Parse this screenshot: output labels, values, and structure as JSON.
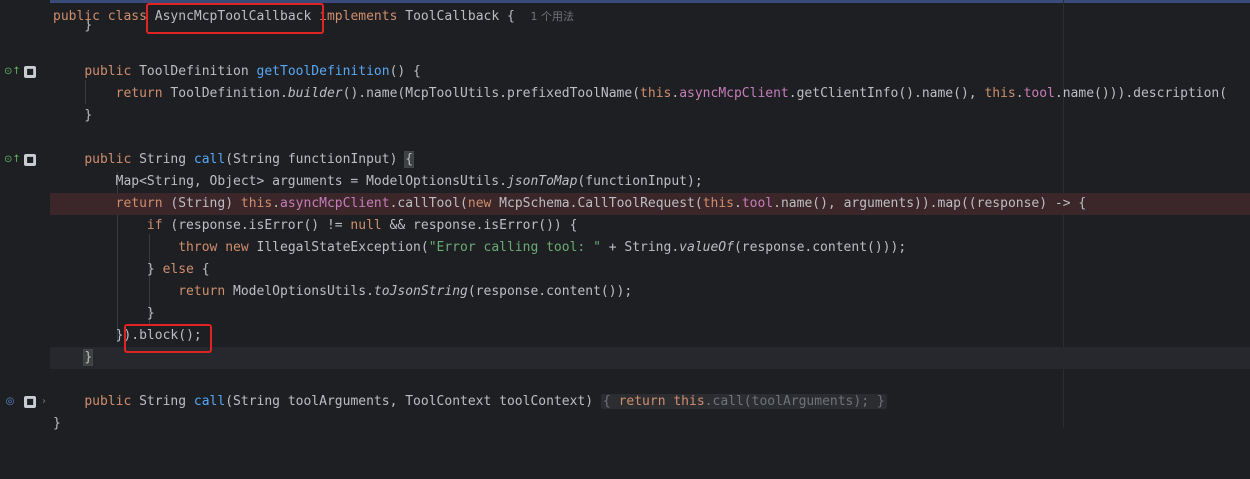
{
  "editor": {
    "usage_hint": "1 个用法",
    "lines": {
      "class_decl": {
        "public": "public",
        "class": "class",
        "name": "AsyncMcpToolCallback",
        "implements": "implements",
        "iface": "ToolCallback",
        "brace": "{"
      },
      "close_prev": "}",
      "getdef_sig": {
        "public": "public",
        "type": "ToolDefinition",
        "method": "getToolDefinition",
        "rest": "() {"
      },
      "getdef_body": {
        "ret": "return",
        "p1": "ToolDefinition.",
        "builder": "builder",
        "p2": "().name(McpToolUtils.prefixedToolName(",
        "this1": "this",
        "dot1": ".",
        "client": "asyncMcpClient",
        "p3": ".getClientInfo().name(), ",
        "this2": "this",
        "dot2": ".",
        "tool": "tool",
        "p4": ".name())).description("
      },
      "getdef_close": "}",
      "call_sig": {
        "public": "public",
        "type": "String",
        "method": "call",
        "rest": "(String functionInput) ",
        "brace": "{"
      },
      "map_line": {
        "p1": "Map<String, Object> arguments = ModelOptionsUtils.",
        "method": "jsonToMap",
        "p2": "(functionInput);"
      },
      "return_line": {
        "ret": "return",
        "p1": " (String) ",
        "this1": "this",
        "dot1": ".",
        "client": "asyncMcpClient",
        "p2": ".callTool(",
        "new": "new",
        "p3": " McpSchema.CallToolRequest(",
        "this2": "this",
        "dot2": ".",
        "tool": "tool",
        "p4": ".name(), arguments)).map((response) -> {"
      },
      "if_line": {
        "if": "if",
        "p1": " (response.isError() != ",
        "null": "null",
        "p2": " && response.isError()) {"
      },
      "throw_line": {
        "throw": "throw",
        "new": "new",
        "p1": " IllegalStateException(",
        "str": "\"Error calling tool: \"",
        "p2": " + String.",
        "method": "valueOf",
        "p3": "(response.content()));"
      },
      "else_line": {
        "p1": "} ",
        "else": "else",
        "p2": " {"
      },
      "return2_line": {
        "ret": "return",
        "p1": " ModelOptionsUtils.",
        "method": "toJsonString",
        "p2": "(response.content());"
      },
      "close_inner": "}",
      "block_line": {
        "p1": "}",
        "p2": ").block();"
      },
      "close_method": "}",
      "call2_sig": {
        "public": "public",
        "type": "String",
        "method": "call",
        "p1": "(String toolArguments, ToolContext toolContext)",
        "fold_open": "{",
        "ret": "return",
        "this": "this",
        "p2": ".call(toolArguments);",
        "fold_close": "}"
      },
      "class_close": "}"
    }
  }
}
